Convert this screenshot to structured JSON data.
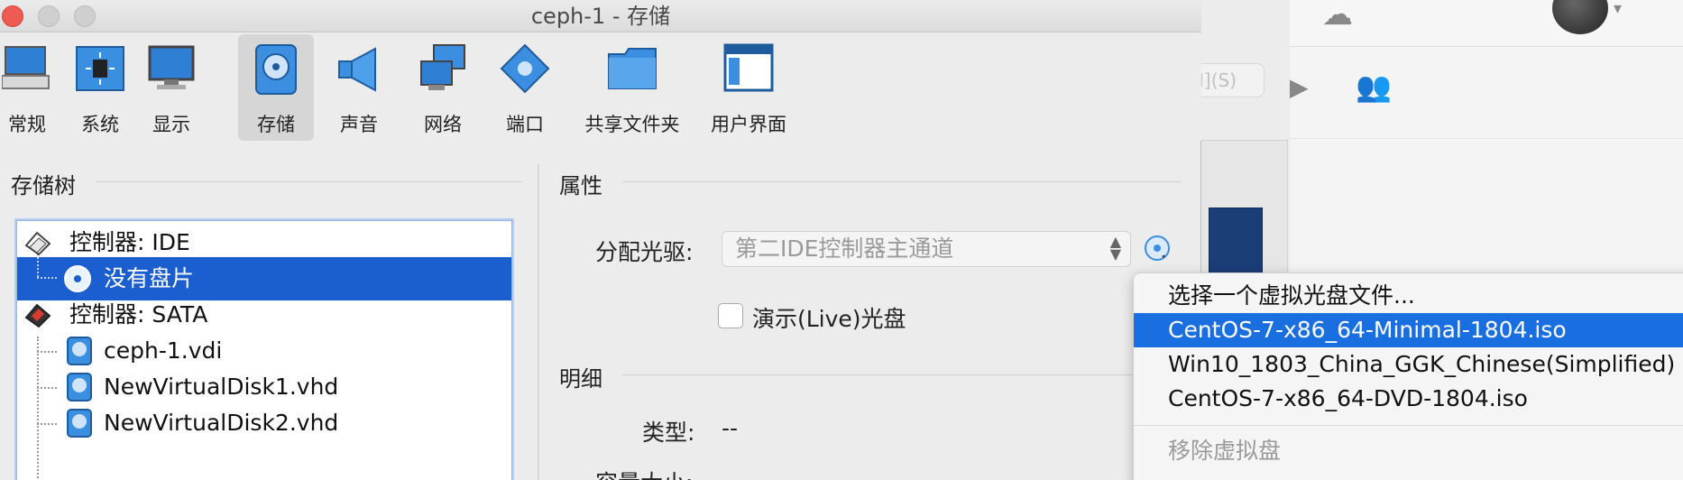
{
  "window": {
    "title": "ceph-1 - 存储"
  },
  "toolbar": {
    "items": [
      {
        "label": "常规",
        "icon": "general-icon"
      },
      {
        "label": "系统",
        "icon": "system-chip-icon"
      },
      {
        "label": "显示",
        "icon": "display-monitor-icon"
      },
      {
        "label": "存储",
        "icon": "storage-disk-icon",
        "selected": true
      },
      {
        "label": "声音",
        "icon": "audio-speaker-icon"
      },
      {
        "label": "网络",
        "icon": "network-icon"
      },
      {
        "label": "端口",
        "icon": "port-connector-icon"
      },
      {
        "label": "共享文件夹",
        "icon": "shared-folder-icon"
      },
      {
        "label": "用户界面",
        "icon": "user-interface-icon"
      }
    ]
  },
  "storage_tree": {
    "header": "存储树",
    "rows": [
      {
        "label": "控制器: IDE",
        "type": "controller"
      },
      {
        "label": "没有盘片",
        "type": "optical",
        "selected": true
      },
      {
        "label": "控制器: SATA",
        "type": "controller"
      },
      {
        "label": "ceph-1.vdi",
        "type": "disk"
      },
      {
        "label": "NewVirtualDisk1.vhd",
        "type": "disk"
      },
      {
        "label": "NewVirtualDisk2.vhd",
        "type": "disk"
      }
    ]
  },
  "attributes": {
    "header": "属性",
    "drive_label": "分配光驱:",
    "drive_value": "第二IDE控制器主通道",
    "live_cd_label": "演示(Live)光盘"
  },
  "details": {
    "header": "明细",
    "type_label": "类型:",
    "type_value": "--",
    "size_label": "容量大小:"
  },
  "popup_menu": {
    "items": [
      {
        "label": "选择一个虚拟光盘文件...",
        "state": "normal"
      },
      {
        "label": "CentOS-7-x86_64-Minimal-1804.iso",
        "state": "highlighted"
      },
      {
        "label": "Win10_1803_China_GGK_Chinese(Simplified)",
        "state": "normal"
      },
      {
        "label": "CentOS-7-x86_64-DVD-1804.iso",
        "state": "normal"
      },
      {
        "label": "移除虚拟盘",
        "state": "disabled"
      }
    ]
  },
  "background": {
    "search_hint": "I](S)"
  },
  "colors": {
    "selection": "#1a5ed0",
    "menu_highlight": "#1a6fe0",
    "window_bg": "#ececec"
  }
}
